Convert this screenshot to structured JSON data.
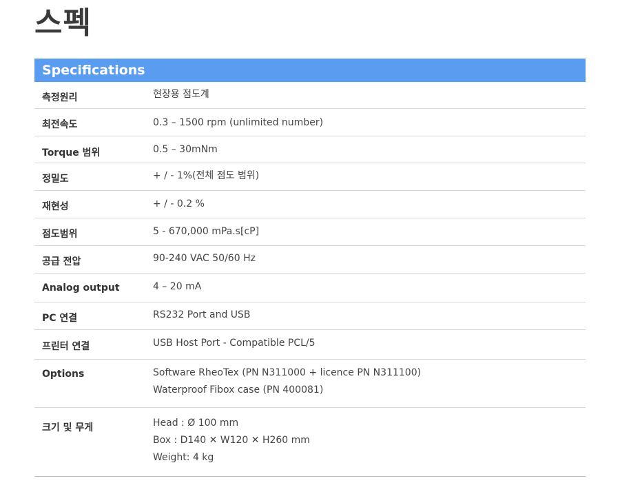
{
  "page_title": "스펙",
  "section_header": "Specifications",
  "rows": [
    {
      "label": "측정원리",
      "lines": [
        "현장용 점도계"
      ]
    },
    {
      "label": "최전속도",
      "lines": [
        "0.3 – 1500 rpm (unlimited number)"
      ]
    },
    {
      "label": "Torque 범위",
      "lines": [
        "0.5 – 30mNm"
      ]
    },
    {
      "label": "정밀도",
      "lines": [
        "+ / - 1%(전체 점도 범위)"
      ]
    },
    {
      "label": "재현성",
      "lines": [
        "+ / - 0.2 %"
      ]
    },
    {
      "label": "점도범위",
      "lines": [
        "5 - 670,000 mPa.s[cP]"
      ]
    },
    {
      "label": "공급 전압",
      "lines": [
        "90-240 VAC 50/60 Hz"
      ]
    },
    {
      "label": "Analog output",
      "lines": [
        "4 – 20 mA"
      ]
    },
    {
      "label": "PC 연결",
      "lines": [
        "RS232 Port and USB"
      ]
    },
    {
      "label": "프린터 연결",
      "lines": [
        "USB Host Port - Compatible PCL/5"
      ]
    },
    {
      "label": "Options",
      "lines": [
        "Software RheoTex (PN N311000 + licence PN N311100)",
        "Waterproof Fibox case (PN 400081)"
      ]
    },
    {
      "label": "크기 및 무게",
      "lines": [
        "Head : Ø 100 mm",
        "Box : D140 ✕ W120 ✕ H260 mm",
        "Weight: 4 kg"
      ]
    }
  ]
}
